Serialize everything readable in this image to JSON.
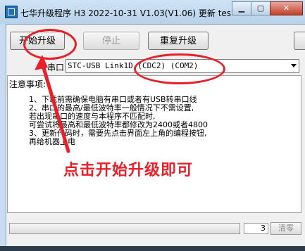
{
  "window": {
    "title": "七华升级程序 H3 2022-10-31 V1.03(V1.06) 更新 tes...",
    "icon": "app-icon",
    "controls": [
      "minimize",
      "maximize",
      "close"
    ]
  },
  "toolbar": {
    "start_upgrade": "开始升级",
    "stop": "停止",
    "repeat_upgrade": "重复升级"
  },
  "port": {
    "label": "串口",
    "selected": "STC-USB Link1D (CDC2) (COM2)"
  },
  "notes": {
    "heading": "注意事项:",
    "lines": [
      "1、下载前需确保电脑有串口或者有USB转串口线",
      "2、串口的最高/最低波特率一般情况下不需设置,",
      "    若出现串口的速度与本程序不匹配时,",
      "    可尝试将最高和最低波特率都修改为2400或者4800",
      "3、更新代码时，需要先点击界面左上角的编程按钮,",
      "    再给机器上电"
    ]
  },
  "status": {
    "count": "3",
    "clear": "清零"
  },
  "annotation": {
    "text": "点击开始升级即可",
    "color": "#e8202a"
  }
}
